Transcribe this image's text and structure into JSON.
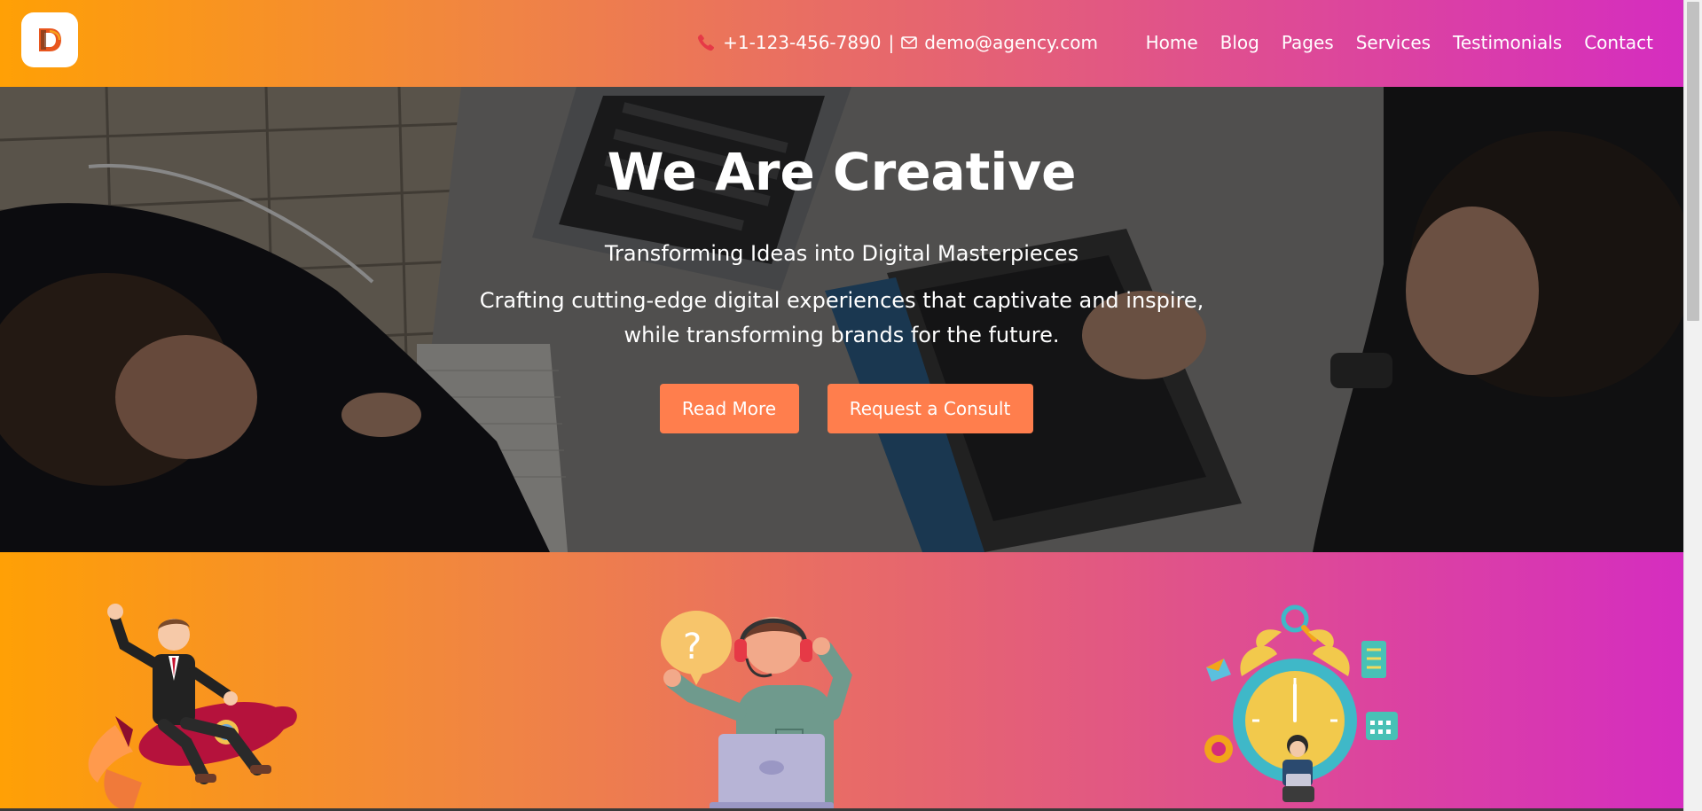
{
  "header": {
    "logo_letter": "D",
    "logo_icon": "brand-logo",
    "contact": {
      "phone_icon": "phone-icon",
      "phone": "+1-123-456-7890",
      "separator": "|",
      "mail_icon": "mail-icon",
      "email": "demo@agency.com"
    },
    "nav": [
      {
        "label": "Home"
      },
      {
        "label": "Blog"
      },
      {
        "label": "Pages"
      },
      {
        "label": "Services"
      },
      {
        "label": "Testimonials"
      },
      {
        "label": "Contact"
      }
    ]
  },
  "hero": {
    "title": "We Are Creative",
    "subtitle": "Transforming Ideas into Digital Masterpieces",
    "text": "Crafting cutting-edge digital experiences that captivate and inspire, while transforming brands for the future.",
    "buttons": {
      "read_more": "Read More",
      "consult": "Request a Consult"
    }
  },
  "features": [
    {
      "illustration": "rocket-businessman-illustration"
    },
    {
      "illustration": "support-agent-illustration"
    },
    {
      "illustration": "alarm-clock-productivity-illustration"
    }
  ],
  "colors": {
    "gradient_start": "#ffa005",
    "gradient_end": "#d52dc0",
    "button": "#ff7e4d"
  }
}
